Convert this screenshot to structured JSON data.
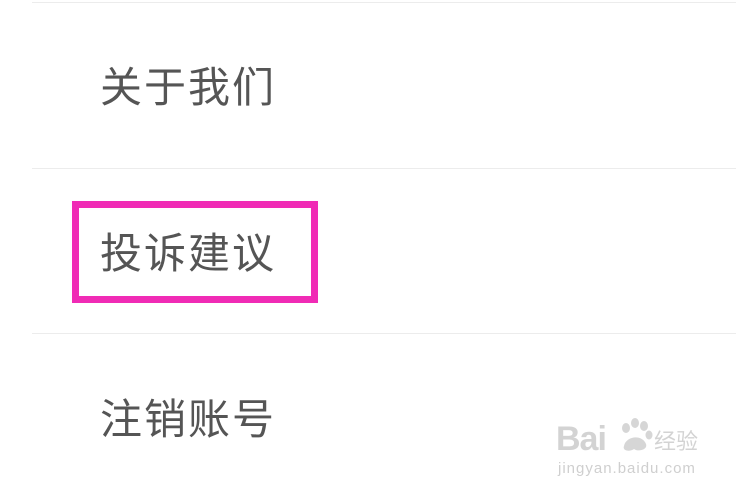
{
  "menu": {
    "items": [
      {
        "label": "关于我们"
      },
      {
        "label": "投诉建议",
        "highlighted": true
      },
      {
        "label": "注销账号"
      }
    ],
    "highlight_color": "#f02bb5",
    "text_color": "#555555",
    "divider_color": "#ececec"
  },
  "watermark": {
    "brand_left": "Bai",
    "brand_right": "经验",
    "url": "jingyan.baidu.com",
    "icon": "baidu-paw-icon"
  }
}
